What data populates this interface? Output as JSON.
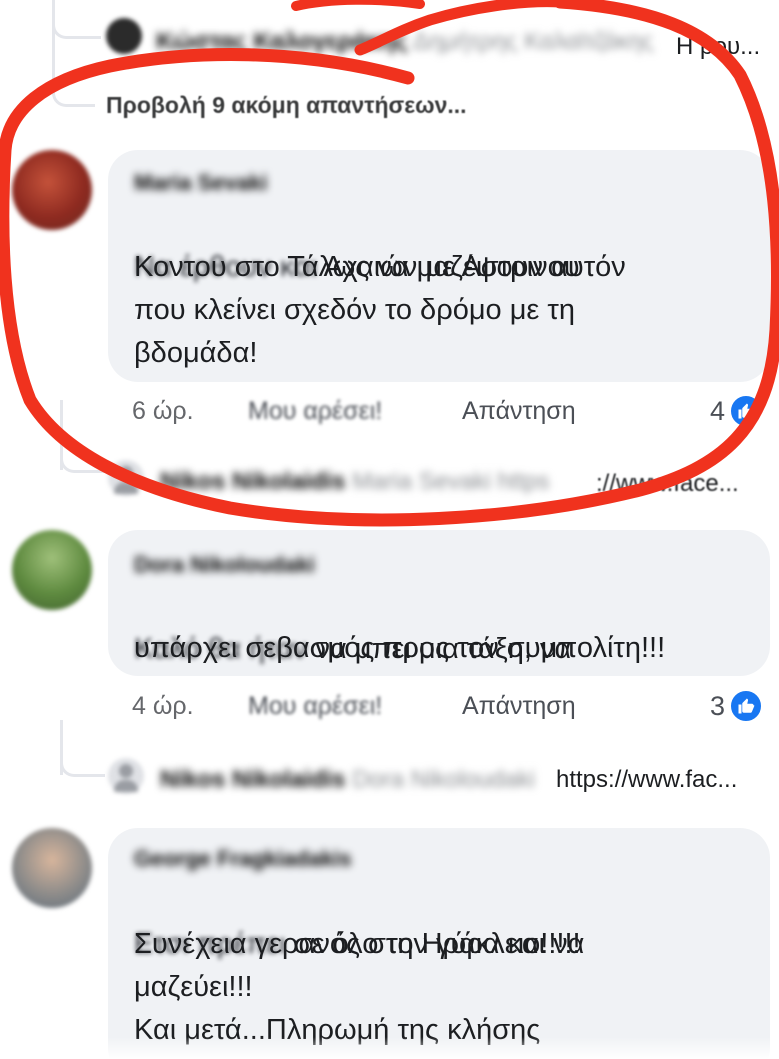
{
  "top_reply": {
    "author": "Κώστας Καλογεράκης",
    "blurred_text": "Δημήτρης Καλαϊτζάκης",
    "visible_text": "Η ρου..."
  },
  "more_replies_label": "Προβολή 9 ακόμη απαντήσεων...",
  "comments": [
    {
      "author": "Maria Sevaki",
      "text_blurred": "Να έρθουν και",
      "text_line1_rest": " Αχαιών με Αστρινου",
      "text_rest": "Κοντου  στο Τάλως να  μαζέψουν αυτόν\nπου κλείνει σχεδόν  το δρόμο με τη\nβδομάδα!",
      "time": "6 ώρ.",
      "like_label": "Μου αρέσει!",
      "reply_label": "Απάντηση",
      "reactions": "4",
      "reply": {
        "author": "Nikos Nikolaidis",
        "blurred": "Maria Sevaki https",
        "visible": "://www.face..."
      }
    },
    {
      "author": "Dora Nikoloudaki",
      "text_blurred": "Καλό θα ήταν",
      "text_line1_rest": " να μπει μια τάξη, να",
      "text_rest": "υπάρχει σεβασμός προς τον συμπολίτη!!!",
      "time": "4 ώρ.",
      "like_label": "Μου αρέσει!",
      "reply_label": "Απάντηση",
      "reactions": "3",
      "reply": {
        "author": "Nikos Nikolaidis",
        "blurred": "Dora Nikoloudaki",
        "visible": "https://www.fac..."
      }
    },
    {
      "author": "George Fragkiadakis",
      "text_blurred": "Ετσι πρέπει",
      "text_line1_rest": " σε όλο το Ηράκλειο!!!!!",
      "text_rest": "Συνέχεια γερανός στην γύρα και να\nμαζεύει!!!\nΚαι μετά...Πληρωμή της κλήσης"
    }
  ],
  "colors": {
    "annotation_red": "#f0321e",
    "like_blue": "#1877f2",
    "bubble_gray": "#f0f2f5"
  },
  "icons": {
    "like": "thumbs-up-icon",
    "avatar_placeholder": "default-person-icon"
  }
}
